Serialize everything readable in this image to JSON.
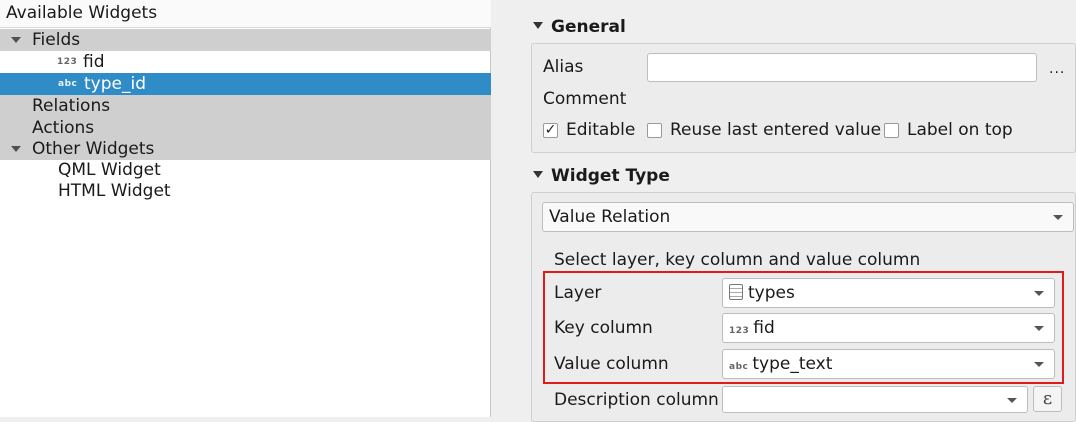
{
  "tree": {
    "header": "Available Widgets",
    "items": [
      {
        "label": "Fields"
      },
      {
        "label": "fid",
        "type_icon": "123"
      },
      {
        "label": "type_id",
        "type_icon": "abc"
      },
      {
        "label": "Relations"
      },
      {
        "label": "Actions"
      },
      {
        "label": "Other Widgets"
      },
      {
        "label": "QML Widget"
      },
      {
        "label": "HTML Widget"
      }
    ]
  },
  "general": {
    "title": "General",
    "alias_label": "Alias",
    "alias_value": "",
    "more_button": "...",
    "comment_label": "Comment",
    "editable_label": "Editable",
    "editable_checked": true,
    "editable_mark": "✓",
    "reuse_label": "Reuse last entered value",
    "reuse_checked": false,
    "label_on_top_label": "Label on top",
    "label_on_top_checked": false
  },
  "widget_type": {
    "title": "Widget Type",
    "selected": "Value Relation",
    "instruction": "Select layer, key column and value column",
    "layer_label": "Layer",
    "layer_value": "types",
    "key_column_label": "Key column",
    "key_column_icon": "123",
    "key_column_value": "fid",
    "value_column_label": "Value column",
    "value_column_icon": "abc",
    "value_column_value": "type_text",
    "description_column_label": "Description column",
    "description_column_value": "",
    "expression_button": "ε"
  },
  "colors": {
    "selection_blue": "#308cc6",
    "selection_gray": "#cfcfcf",
    "highlight_red": "#e01b1b"
  }
}
